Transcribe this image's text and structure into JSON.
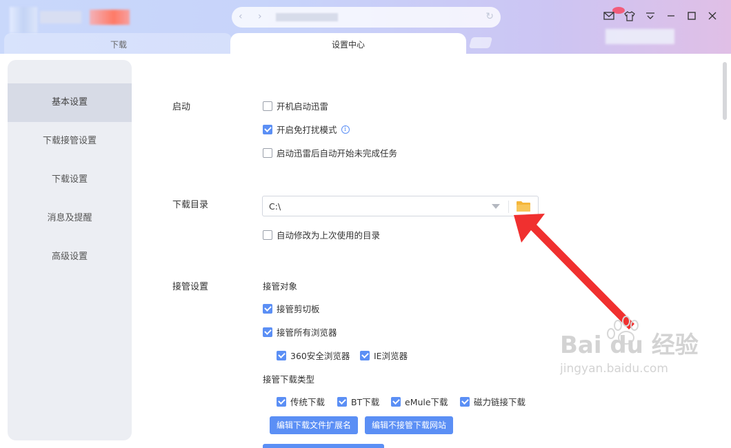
{
  "titlebar": {
    "tabs": [
      {
        "label": "下载"
      },
      {
        "label": "设置中心"
      }
    ]
  },
  "sidebar": {
    "items": [
      {
        "label": "基本设置",
        "active": true
      },
      {
        "label": "下载接管设置"
      },
      {
        "label": "下载设置"
      },
      {
        "label": "消息及提醒"
      },
      {
        "label": "高级设置"
      }
    ]
  },
  "startup": {
    "title": "启动",
    "options": [
      {
        "label": "开机启动迅雷",
        "checked": false
      },
      {
        "label": "开启免打扰模式",
        "checked": true
      },
      {
        "label": "启动迅雷后自动开始未完成任务",
        "checked": false
      }
    ]
  },
  "download_dir": {
    "title": "下载目录",
    "value": "C:\\",
    "auto_change": {
      "label": "自动修改为上次使用的目录",
      "checked": false
    }
  },
  "takeover": {
    "title": "接管设置",
    "objects_label": "接管对象",
    "clipboard": {
      "label": "接管剪切板",
      "checked": true
    },
    "all_browsers": {
      "label": "接管所有浏览器",
      "checked": true
    },
    "browsers": [
      {
        "label": "360安全浏览器",
        "checked": true
      },
      {
        "label": "IE浏览器",
        "checked": true
      }
    ],
    "types_label": "接管下载类型",
    "types": [
      {
        "label": "传统下载",
        "checked": true
      },
      {
        "label": "BT下载",
        "checked": true
      },
      {
        "label": "eMule下载",
        "checked": true
      },
      {
        "label": "磁力链接下载",
        "checked": true
      }
    ],
    "buttons": [
      {
        "label": "编辑下载文件扩展名"
      },
      {
        "label": "编辑不接管下载网站"
      }
    ]
  },
  "watermark": {
    "brand": "Bai du 经验",
    "url": "jingyan.baidu.com"
  },
  "colors": {
    "accent": "#5b8ff5",
    "arrow": "#f0302f",
    "folder": "#f5b63a"
  }
}
